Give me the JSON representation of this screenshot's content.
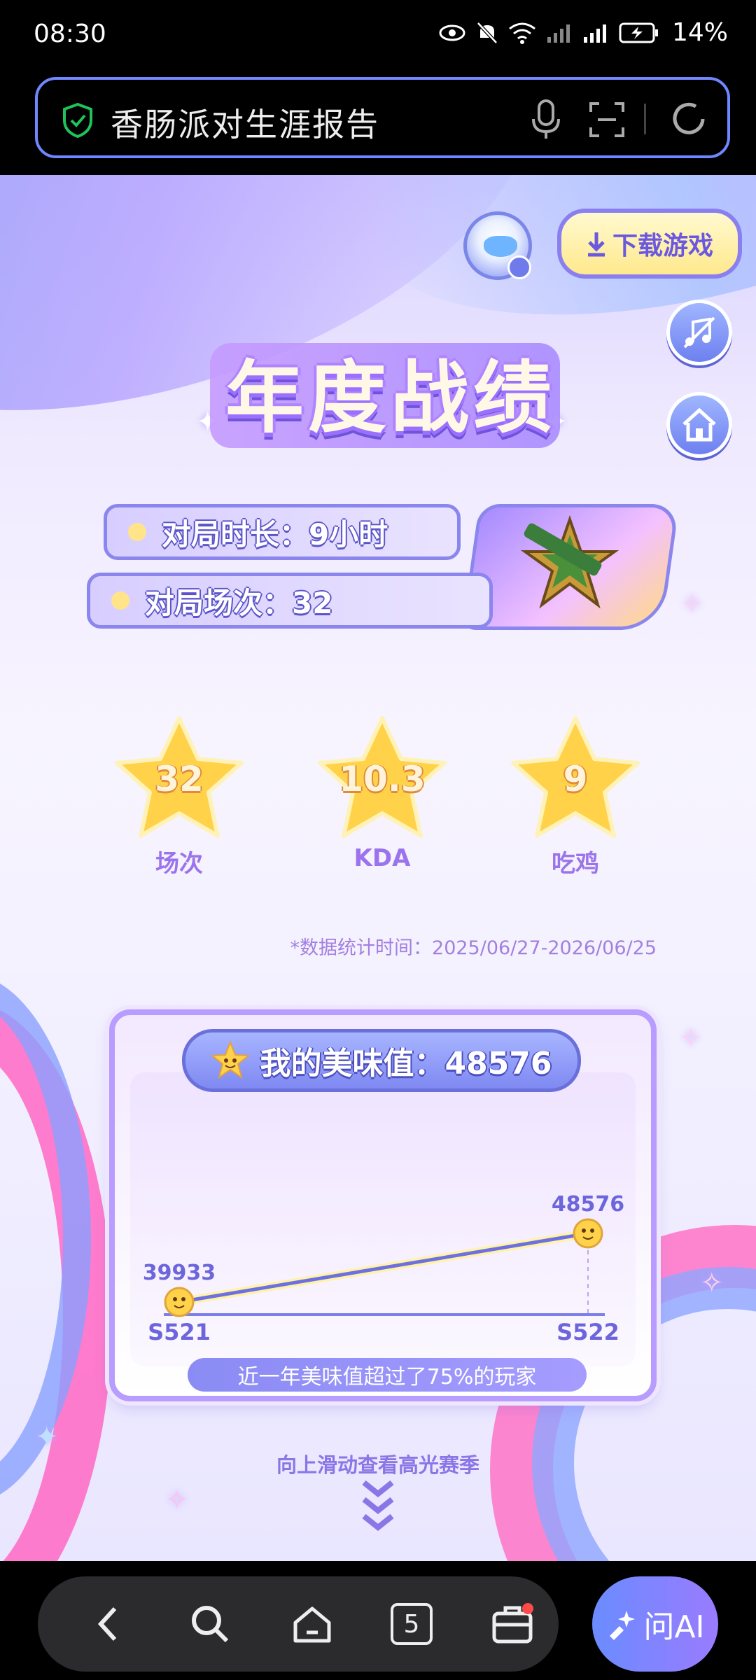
{
  "status_bar": {
    "time": "08:30",
    "battery": "14%"
  },
  "url_bar": {
    "title": "香肠派对生涯报告"
  },
  "page": {
    "download_label": "下载游戏",
    "title": "年度战绩",
    "stats": {
      "duration": "对局时长：9小时",
      "matches": "对局场次：32"
    },
    "stars": [
      {
        "value": "32",
        "label": "场次"
      },
      {
        "value": "10.3",
        "label": "KDA"
      },
      {
        "value": "9",
        "label": "吃鸡"
      }
    ],
    "stat_time": "*数据统计时间：2025/06/27-2026/06/25",
    "score": {
      "header": "我的美味值：48576",
      "compare": "近一年美味值超过了75%的玩家"
    },
    "scroll_hint": "向上滑动查看高光赛季"
  },
  "chart_data": {
    "type": "line",
    "x": [
      "S521",
      "S522"
    ],
    "series": [
      {
        "values": [
          39933,
          48576
        ]
      }
    ],
    "data_labels": [
      "39933",
      "48576"
    ]
  },
  "bottom_nav": {
    "tabs_count": "5",
    "ai_label": "问AI"
  },
  "colors": {
    "accent": "#6f87ff",
    "title_purple": "#9b70ff",
    "star_gold": "#ffd24a",
    "pink": "#ff6fc8"
  }
}
